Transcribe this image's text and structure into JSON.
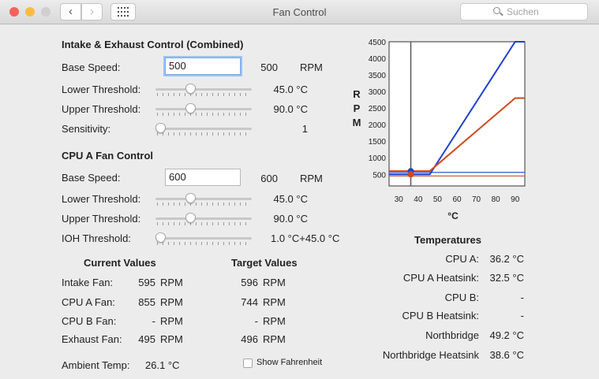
{
  "window": {
    "title": "Fan Control",
    "search_placeholder": "Suchen"
  },
  "colors": {
    "close": "#fc605c",
    "minimize": "#fdbc40",
    "zoom_inactive": "#cfcfcf",
    "line_blue": "#2040d0",
    "line_red": "#d04a20",
    "input_focus": "#7aa7e7"
  },
  "icons": {
    "back": "chevron-left-icon",
    "forward": "chevron-right-icon",
    "grid": "grid-icon",
    "search": "search-icon"
  },
  "intake": {
    "heading": "Intake & Exhaust Control (Combined)",
    "base_speed_label": "Base Speed:",
    "base_speed_input": "500",
    "base_speed_value": "500",
    "rpm": "RPM",
    "lower_label": "Lower Threshold:",
    "lower_value": "45.0 °C",
    "lower_slider": 0.35,
    "upper_label": "Upper Threshold:",
    "upper_value": "90.0 °C",
    "upper_slider": 0.35,
    "sens_label": "Sensitivity:",
    "sens_value": "1",
    "sens_slider": 0.0
  },
  "cpu_a": {
    "heading": "CPU A Fan Control",
    "base_speed_label": "Base Speed:",
    "base_speed_input": "600",
    "base_speed_value": "600",
    "rpm": "RPM",
    "lower_label": "Lower Threshold:",
    "lower_value": "45.0 °C",
    "lower_slider": 0.35,
    "upper_label": "Upper Threshold:",
    "upper_value": "90.0 °C",
    "upper_slider": 0.35,
    "ioh_label": "IOH Threshold:",
    "ioh_value": "1.0 °C+45.0 °C",
    "ioh_slider": 0.0
  },
  "current": {
    "heading": "Current Values",
    "rows": [
      {
        "label": "Intake Fan:",
        "value": "595",
        "unit": "RPM"
      },
      {
        "label": "CPU A Fan:",
        "value": "855",
        "unit": "RPM"
      },
      {
        "label": "CPU B Fan:",
        "value": "-",
        "unit": "RPM"
      },
      {
        "label": "Exhaust Fan:",
        "value": "495",
        "unit": "RPM"
      }
    ]
  },
  "target": {
    "heading": "Target Values",
    "rows": [
      {
        "value": "596",
        "unit": "RPM"
      },
      {
        "value": "744",
        "unit": "RPM"
      },
      {
        "value": "-",
        "unit": "RPM"
      },
      {
        "value": "496",
        "unit": "RPM"
      }
    ]
  },
  "ambient": {
    "label": "Ambient Temp:",
    "value": "26.1 °C"
  },
  "show_fahrenheit": {
    "label": "Show Fahrenheit",
    "checked": false
  },
  "temperatures": {
    "heading": "Temperatures",
    "rows": [
      {
        "label": "CPU A:",
        "value": "36.2 °C"
      },
      {
        "label": "CPU A Heatsink:",
        "value": "32.5 °C"
      },
      {
        "label": "CPU B:",
        "value": "-"
      },
      {
        "label": "CPU B Heatsink:",
        "value": "-"
      },
      {
        "label": "Northbridge",
        "value": "49.2 °C"
      },
      {
        "label": "Northbridge Heatsink",
        "value": "38.6 °C"
      }
    ]
  },
  "chart_data": {
    "type": "line",
    "title": "",
    "xlabel": "°C",
    "ylabel": "R P M",
    "ylabel_letters": [
      "R",
      "P",
      "M"
    ],
    "xlim": [
      25,
      95
    ],
    "ylim": [
      150,
      4500
    ],
    "x_ticks": [
      30,
      40,
      50,
      60,
      70,
      80,
      90
    ],
    "x_tick_labels": [
      "30",
      "40",
      "50",
      "60",
      "70",
      "80",
      "90"
    ],
    "y_ticks": [
      500,
      1000,
      1500,
      2000,
      2500,
      3000,
      3500,
      4000,
      4500
    ],
    "y_tick_labels": [
      "500",
      "1000",
      "1500",
      "2000",
      "2500",
      "3000",
      "3500",
      "4000",
      "4500"
    ],
    "series": [
      {
        "color": "#2040d0",
        "points": [
          [
            25,
            500
          ],
          [
            46,
            500
          ],
          [
            90,
            4500
          ],
          [
            95,
            4500
          ]
        ]
      },
      {
        "color": "#d04a20",
        "points": [
          [
            25,
            600
          ],
          [
            46,
            600
          ],
          [
            90,
            2800
          ],
          [
            95,
            2800
          ]
        ]
      }
    ],
    "reference_lines": [
      {
        "axis": "y",
        "value": 560,
        "color": "#5070d8"
      },
      {
        "axis": "y",
        "value": 450,
        "color": "#d07050"
      }
    ],
    "current_temp_marker": 36.2,
    "markers": [
      {
        "x": 36.2,
        "y": 595,
        "color": "#2040d0"
      },
      {
        "x": 36.2,
        "y": 500,
        "color": "#d04a20"
      }
    ]
  }
}
